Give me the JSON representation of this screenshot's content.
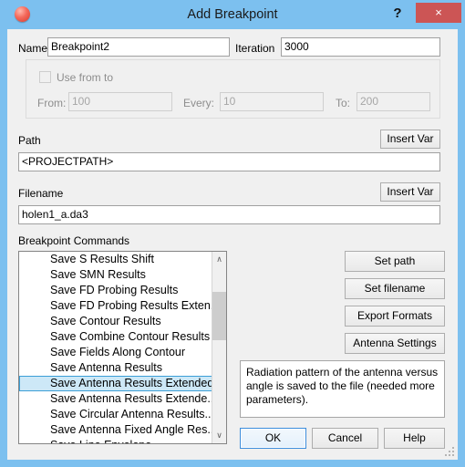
{
  "window": {
    "title": "Add Breakpoint",
    "icon": "red-sphere-icon",
    "help_label": "?",
    "close_label": "×"
  },
  "form": {
    "name_label": "Name",
    "name_value": "Breakpoint2",
    "iteration_label": "Iteration",
    "iteration_value": "3000",
    "use_from_to_label": "Use from to",
    "use_from_to_checked": false,
    "from_label": "From:",
    "from_value": "100",
    "every_label": "Every:",
    "every_value": "10",
    "to_label": "To:",
    "to_value": "200",
    "path_label": "Path",
    "path_value": "<PROJECTPATH>",
    "path_insert_var_label": "Insert Var",
    "filename_label": "Filename",
    "filename_value": "holen1_a.da3",
    "filename_insert_var_label": "Insert Var"
  },
  "commands": {
    "label": "Breakpoint Commands",
    "selected_index": 8,
    "items": [
      "Save S Results Shift",
      "Save SMN Results",
      "Save FD Probing Results",
      "Save FD Probing Results Exten...",
      "Save Contour Results",
      "Save Combine Contour Results",
      "Save Fields Along Contour",
      "Save Antenna Results",
      "Save Antenna Results Extended",
      "Save Antenna Results Extende...",
      "Save Circular Antenna Results...",
      "Save Antenna Fixed Angle Res...",
      "Save Line Envelope"
    ],
    "scroll_up_glyph": "∧",
    "scroll_down_glyph": "∨"
  },
  "side_buttons": {
    "set_path": "Set path",
    "set_filename": "Set filename",
    "export_formats": "Export Formats",
    "antenna_settings": "Antenna Settings"
  },
  "description": {
    "text": "Radiation pattern of the antenna versus angle is saved to the file (needed more parameters)."
  },
  "dialog_buttons": {
    "ok": "OK",
    "cancel": "Cancel",
    "help": "Help"
  },
  "colors": {
    "titlebar": "#7cc0ef",
    "close_button": "#c55555",
    "selection": "#cde8f7",
    "selection_border": "#3c9fd6",
    "client": "#f0f0f0"
  }
}
